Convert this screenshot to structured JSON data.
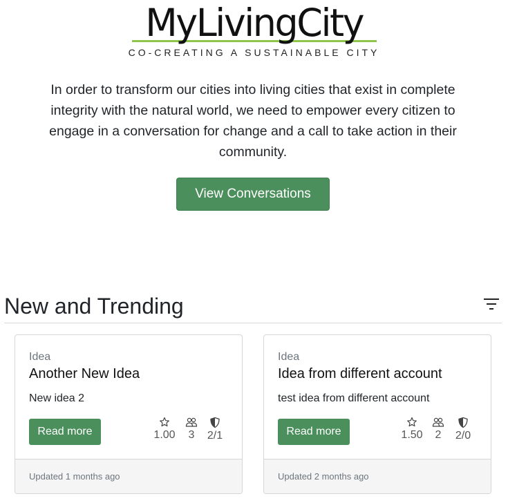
{
  "logo": {
    "title": "MyLivingCity",
    "tagline": "CO-CREATING A SUSTAINABLE CITY"
  },
  "intro": {
    "text": "In order to transform our cities into living cities that exist in complete integrity with the natural world, we need to empower every citizen to engage in a conversation for change and a call to take action in their community."
  },
  "cta": {
    "label": "View Conversations"
  },
  "section": {
    "title": "New and Trending",
    "filter_icon": "filter-icon"
  },
  "colors": {
    "primary_button": "#4b8f5c",
    "logo_underline": "#8cc54a",
    "footer_bg": "#f5f5f5"
  },
  "cards": [
    {
      "type": "Idea",
      "title": "Another New Idea",
      "description": "New idea 2",
      "read_more": "Read more",
      "rating": "1.00",
      "participants": "3",
      "votes": "2/1",
      "updated": "Updated 1 months ago"
    },
    {
      "type": "Idea",
      "title": "Idea from different account",
      "description": "test idea from different account",
      "read_more": "Read more",
      "rating": "1.50",
      "participants": "2",
      "votes": "2/0",
      "updated": "Updated 2 months ago"
    }
  ]
}
